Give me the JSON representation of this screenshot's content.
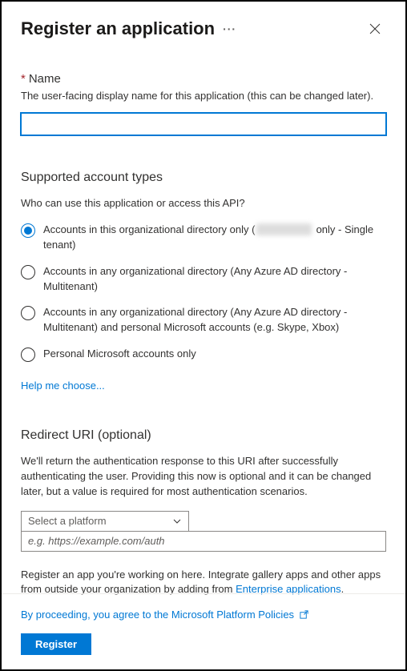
{
  "header": {
    "title": "Register an application"
  },
  "name_section": {
    "label": "Name",
    "description": "The user-facing display name for this application (this can be changed later).",
    "value": ""
  },
  "account_types": {
    "title": "Supported account types",
    "question": "Who can use this application or access this API?",
    "options": [
      {
        "label_before": "Accounts in this organizational directory only (",
        "label_hidden": "xxxxx",
        "label_after": " only - Single tenant)",
        "selected": true
      },
      {
        "label": "Accounts in any organizational directory (Any Azure AD directory - Multitenant)",
        "selected": false
      },
      {
        "label": "Accounts in any organizational directory (Any Azure AD directory - Multitenant) and personal Microsoft accounts (e.g. Skype, Xbox)",
        "selected": false
      },
      {
        "label": "Personal Microsoft accounts only",
        "selected": false
      }
    ],
    "help_link": "Help me choose..."
  },
  "redirect": {
    "title": "Redirect URI (optional)",
    "description": "We'll return the authentication response to this URI after successfully authenticating the user. Providing this now is optional and it can be changed later, but a value is required for most authentication scenarios.",
    "platform_placeholder": "Select a platform",
    "uri_placeholder": "e.g. https://example.com/auth"
  },
  "info": {
    "text_before": "Register an app you're working on here. Integrate gallery apps and other apps from outside your organization by adding from ",
    "link": "Enterprise applications",
    "text_after": "."
  },
  "footer": {
    "policy_text": "By proceeding, you agree to the Microsoft Platform Policies",
    "register_label": "Register"
  }
}
